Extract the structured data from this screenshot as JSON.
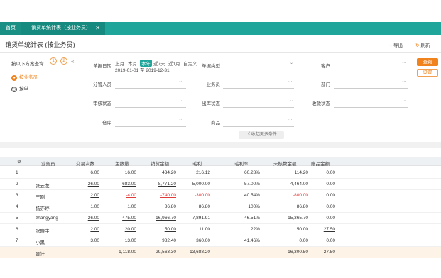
{
  "tabs": {
    "home": "首页",
    "active": "销货单统计表（按业务员）",
    "close": "✕"
  },
  "page": {
    "title": "销货单统计表 (按业务员)",
    "export_label": "导出",
    "print_label": "刷新"
  },
  "quick": {
    "title": "按以下方案查询",
    "badge_1": "1",
    "badge_2": "2",
    "collapse": "«",
    "items": [
      {
        "label": "按业务员",
        "icon": "person-icon"
      },
      {
        "label": "按单",
        "icon": "clock-icon"
      }
    ]
  },
  "filters": {
    "date_label": "单据日期",
    "periods": [
      "上月",
      "本月",
      "本年",
      "近7天",
      "近1月",
      "自定义"
    ],
    "selected_period": "本年",
    "date_range": "2019-01-01 至 2019-12-31",
    "doc_status_label": "单据类型",
    "customer_label": "客户",
    "manager_label": "分管人员",
    "salesman_label": "业务员",
    "dept_label": "部门",
    "review_label": "审核状态",
    "outbound_label": "出库状态",
    "receipt_label": "收款状态",
    "warehouse_label": "仓库",
    "product_label": "商品",
    "dots": "···",
    "chev": "⌄",
    "query_button": "查询",
    "reset_button": "设置",
    "more_conditions": "《 收起更多条件"
  },
  "grid": {
    "headers": [
      "业务员",
      "交易次数",
      "主数量",
      "销货金额",
      "毛利",
      "毛利率",
      "未核数金额",
      "赠品金额"
    ],
    "rows": [
      {
        "no": "1",
        "name": "",
        "trades": "6.00",
        "qty": "16.00",
        "amount": "434.20",
        "profit": "216.12",
        "rate": "60.28%",
        "unpaid": "114.20",
        "gift": "0.00",
        "ul": false,
        "neg": false
      },
      {
        "no": "2",
        "name": "张云龙",
        "trades": "26.00",
        "qty": "683.00",
        "amount": "8,771.20",
        "profit": "5,000.00",
        "rate": "57.00%",
        "unpaid": "4,464.00",
        "gift": "0.00",
        "ul": true,
        "neg": false
      },
      {
        "no": "3",
        "name": "王刚",
        "trades": "2.00",
        "qty": "-4.00",
        "amount": "-740.00",
        "profit": "-300.00",
        "rate": "40.54%",
        "unpaid": "-800.00",
        "gift": "0.00",
        "ul": true,
        "neg": true
      },
      {
        "no": "4",
        "name": "杨亦婷",
        "trades": "1.00",
        "qty": "1.00",
        "amount": "86.80",
        "profit": "86.80",
        "rate": "100%",
        "unpaid": "86.80",
        "gift": "0.00",
        "ul": false,
        "neg": false
      },
      {
        "no": "5",
        "name": "zhangyang",
        "trades": "26.00",
        "qty": "475.00",
        "amount": "16,966.70",
        "profit": "7,891.91",
        "rate": "46.51%",
        "unpaid": "15,365.70",
        "gift": "0.00",
        "ul": true,
        "neg": false
      },
      {
        "no": "6",
        "name": "张晓宇",
        "trades": "2.00",
        "qty": "20.00",
        "amount": "50.00",
        "profit": "11.00",
        "rate": "22%",
        "unpaid": "50.00",
        "gift": "27.50",
        "ul": true,
        "neg": false
      },
      {
        "no": "7",
        "name": "小黑",
        "trades": "3.00",
        "qty": "13.00",
        "amount": "982.40",
        "profit": "360.00",
        "rate": "41.46%",
        "unpaid": "0.00",
        "gift": "0.00",
        "ul": false,
        "neg": false
      }
    ],
    "total": {
      "label": "合计",
      "qty": "1,118.00",
      "amount": "29,563.30",
      "profit": "13,688.20",
      "unpaid": "16,300.50",
      "gift": "27.50"
    }
  },
  "colors": {
    "brand": "#1fa59a",
    "accent": "#f0831e",
    "negative": "#e03b3b"
  }
}
